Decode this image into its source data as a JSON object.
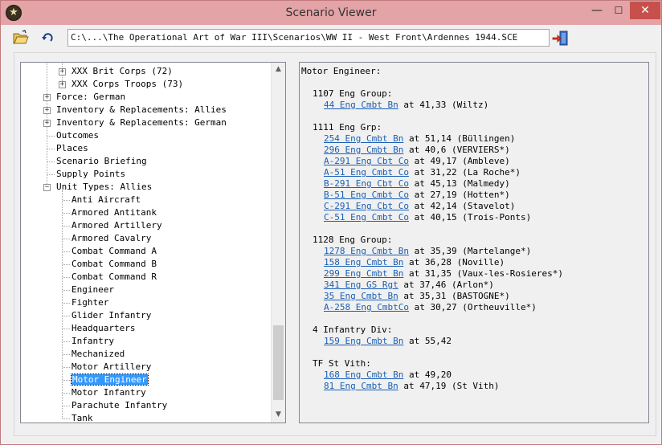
{
  "window": {
    "title": "Scenario Viewer",
    "min_glyph": "—",
    "max_glyph": "☐",
    "close_glyph": "✕",
    "app_icon": "star-badge-icon"
  },
  "toolbar": {
    "open_icon": "folder-open-icon",
    "refresh_icon": "refresh-icon",
    "exit_icon": "exit-door-icon",
    "path": "C:\\...\\The Operational Art of War III\\Scenarios\\WW II - West Front\\Ardennes 1944.SCE"
  },
  "tree": {
    "items": [
      {
        "label": "XXX Brit Corps (72)",
        "level": 3,
        "expander": "+"
      },
      {
        "label": "XXX Corps Troops (73)",
        "level": 3,
        "expander": "+"
      },
      {
        "label": "Force: German",
        "level": 1,
        "expander": "+"
      },
      {
        "label": "Inventory & Replacements: Allies",
        "level": 1,
        "expander": "+"
      },
      {
        "label": "Inventory & Replacements: German",
        "level": 1,
        "expander": "+"
      },
      {
        "label": "Outcomes",
        "level": 1,
        "expander": ""
      },
      {
        "label": "Places",
        "level": 1,
        "expander": ""
      },
      {
        "label": "Scenario Briefing",
        "level": 1,
        "expander": ""
      },
      {
        "label": "Supply Points",
        "level": 1,
        "expander": ""
      },
      {
        "label": "Unit Types: Allies",
        "level": 1,
        "expander": "−"
      },
      {
        "label": "Anti Aircraft",
        "level": 2,
        "expander": ""
      },
      {
        "label": "Armored Antitank",
        "level": 2,
        "expander": ""
      },
      {
        "label": "Armored Artillery",
        "level": 2,
        "expander": ""
      },
      {
        "label": "Armored Cavalry",
        "level": 2,
        "expander": ""
      },
      {
        "label": "Combat Command A",
        "level": 2,
        "expander": ""
      },
      {
        "label": "Combat Command B",
        "level": 2,
        "expander": ""
      },
      {
        "label": "Combat Command R",
        "level": 2,
        "expander": ""
      },
      {
        "label": "Engineer",
        "level": 2,
        "expander": ""
      },
      {
        "label": "Fighter",
        "level": 2,
        "expander": ""
      },
      {
        "label": "Glider Infantry",
        "level": 2,
        "expander": ""
      },
      {
        "label": "Headquarters",
        "level": 2,
        "expander": ""
      },
      {
        "label": "Infantry",
        "level": 2,
        "expander": ""
      },
      {
        "label": "Mechanized",
        "level": 2,
        "expander": ""
      },
      {
        "label": "Motor Artillery",
        "level": 2,
        "expander": ""
      },
      {
        "label": "Motor Engineer",
        "level": 2,
        "expander": "",
        "selected": true
      },
      {
        "label": "Motor Infantry",
        "level": 2,
        "expander": ""
      },
      {
        "label": "Parachute Infantry",
        "level": 2,
        "expander": ""
      },
      {
        "label": "Tank",
        "level": 2,
        "expander": ""
      }
    ],
    "scroll_up_glyph": "▲",
    "scroll_down_glyph": "▼"
  },
  "detail": {
    "heading": "Motor Engineer:",
    "groups": [
      {
        "name": "1107 Eng Group:",
        "units": [
          {
            "unit": "44 Eng Cmbt Bn",
            "info": " at 41,33 (Wiltz)"
          }
        ]
      },
      {
        "name": "1111 Eng Grp:",
        "units": [
          {
            "unit": "254 Eng Cmbt Bn",
            "info": " at 51,14 (Büllingen)"
          },
          {
            "unit": "296 Eng Cmbt Bn",
            "info": " at 40,6 (VERVIERS*)"
          },
          {
            "unit": "A-291 Eng Cbt Co",
            "info": " at 49,17 (Ambleve)"
          },
          {
            "unit": "A-51 Eng Cmbt Co",
            "info": " at 31,22 (La Roche*)"
          },
          {
            "unit": "B-291 Eng Cbt Co",
            "info": " at 45,13 (Malmedy)"
          },
          {
            "unit": "B-51 Eng Cmbt Co",
            "info": " at 27,19 (Hotten*)"
          },
          {
            "unit": "C-291 Eng Cbt Co",
            "info": " at 42,14 (Stavelot)"
          },
          {
            "unit": "C-51 Eng Cmbt Co",
            "info": " at 40,15 (Trois-Ponts)"
          }
        ]
      },
      {
        "name": "1128 Eng Group:",
        "units": [
          {
            "unit": "1278 Eng Cmbt Bn",
            "info": " at 35,39 (Martelange*)"
          },
          {
            "unit": "158 Eng Cmbt Bn",
            "info": " at 36,28 (Noville)"
          },
          {
            "unit": "299 Eng Cmbt Bn",
            "info": " at 31,35 (Vaux-les-Rosieres*)"
          },
          {
            "unit": "341 Eng GS Rgt",
            "info": " at 37,46 (Arlon*)"
          },
          {
            "unit": "35 Eng Cmbt Bn",
            "info": " at 35,31 (BASTOGNE*)"
          },
          {
            "unit": "A-258 Eng CmbtCo",
            "info": " at 30,27 (Ortheuville*)"
          }
        ]
      },
      {
        "name": "4 Infantry Div:",
        "units": [
          {
            "unit": "159 Eng Cmbt Bn",
            "info": " at 55,42"
          }
        ]
      },
      {
        "name": "TF St Vith:",
        "units": [
          {
            "unit": "168 Eng Cmbt Bn",
            "info": " at 49,20"
          },
          {
            "unit": "81 Eng Cmbt Bn",
            "info": " at 47,19 (St Vith)"
          }
        ]
      }
    ]
  }
}
